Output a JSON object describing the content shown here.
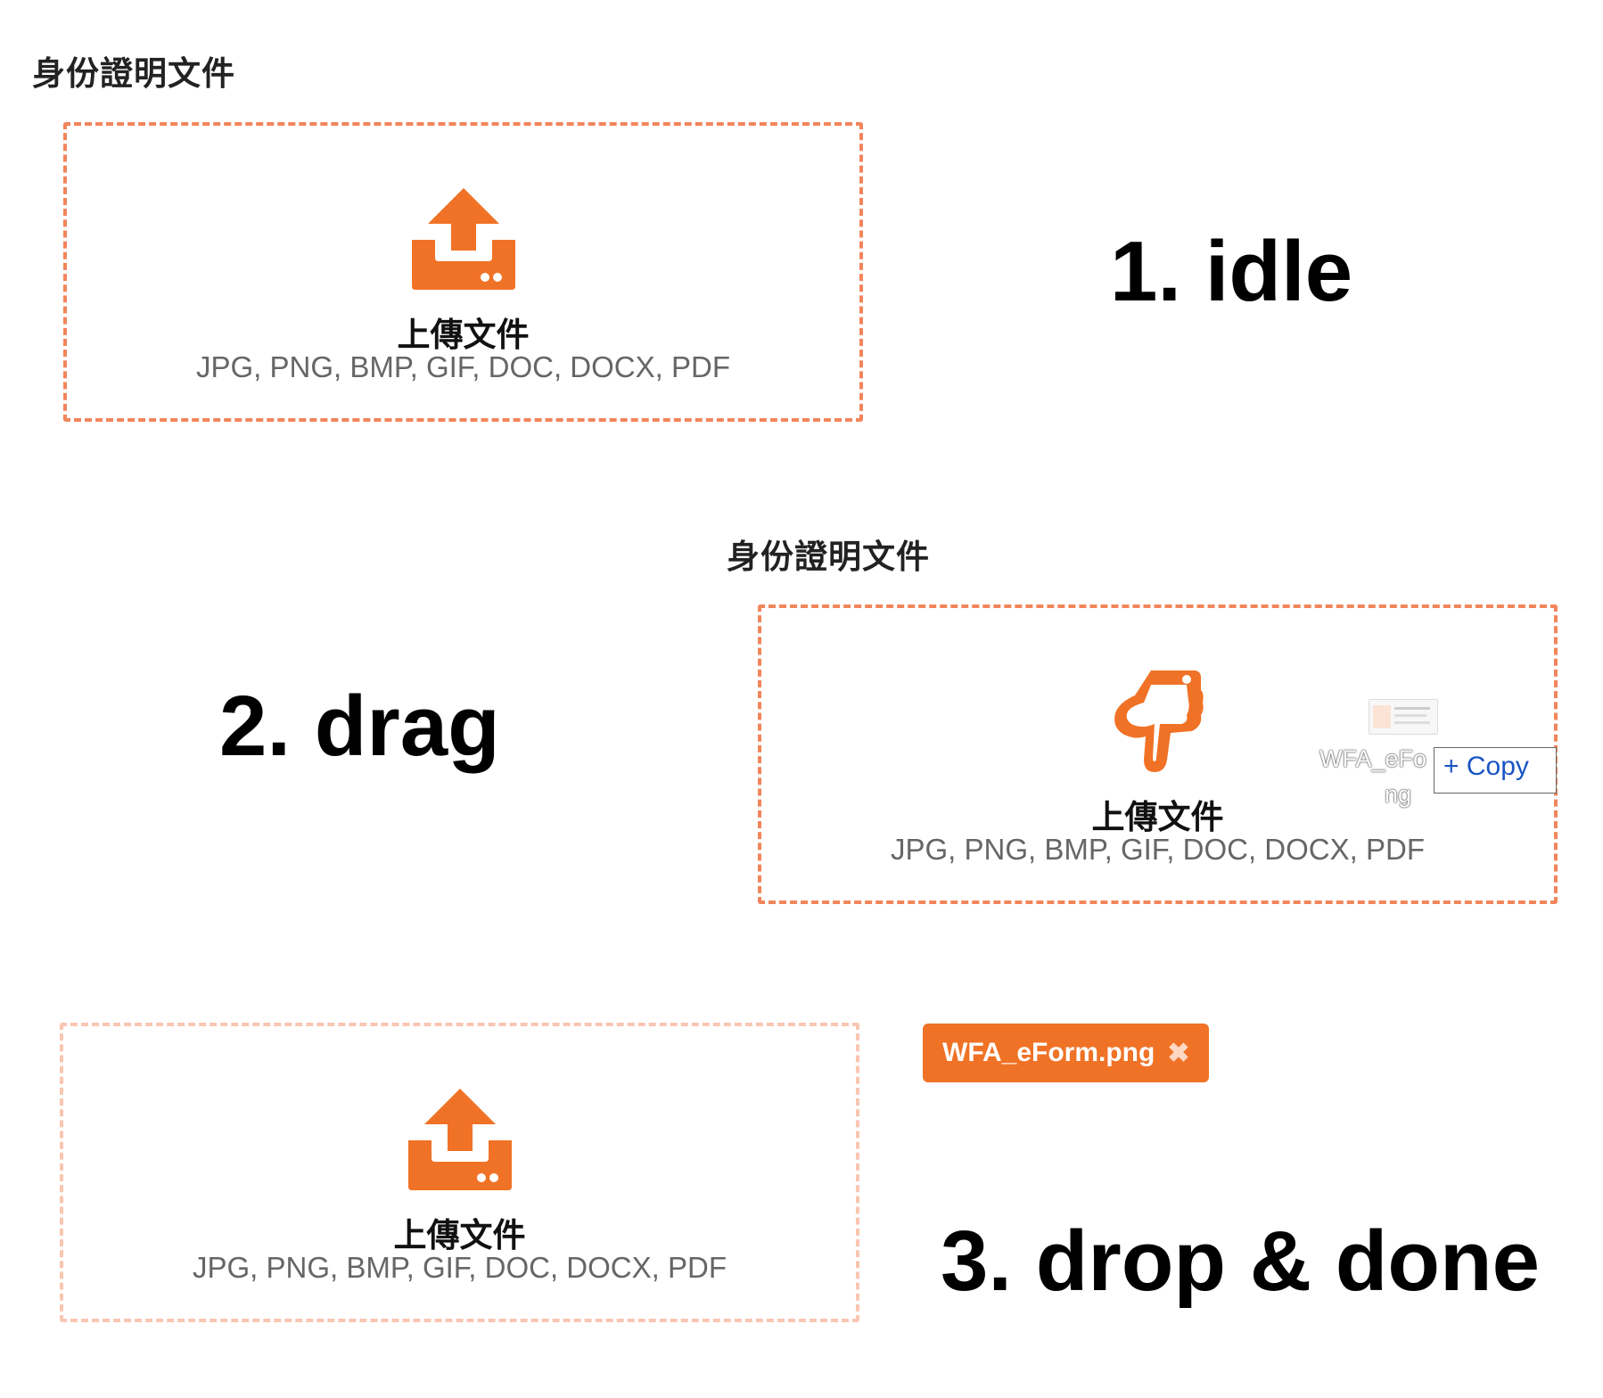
{
  "field_label": "身份證明文件",
  "dropzone": {
    "title": "上傳文件",
    "formats": "JPG, PNG, BMP, GIF, DOC, DOCX, PDF"
  },
  "steps": {
    "idle": "1. idle",
    "drag": "2. drag",
    "done": "3. drop & done"
  },
  "drag_ghost": {
    "file_name_line1": "WFA_eFo",
    "file_name_line2": "ng",
    "copy_label": "+ Copy"
  },
  "uploaded_file": {
    "name": "WFA_eForm.png",
    "remove_icon": "✖"
  },
  "colors": {
    "accent": "#f07226",
    "dashed_border": "#f2855b",
    "dashed_border_faded": "#f9c6b2",
    "copy_text": "#1a55c4"
  },
  "icons": {
    "upload": "upload-tray-icon",
    "drag": "pointing-hand-icon",
    "remove": "close-icon"
  }
}
